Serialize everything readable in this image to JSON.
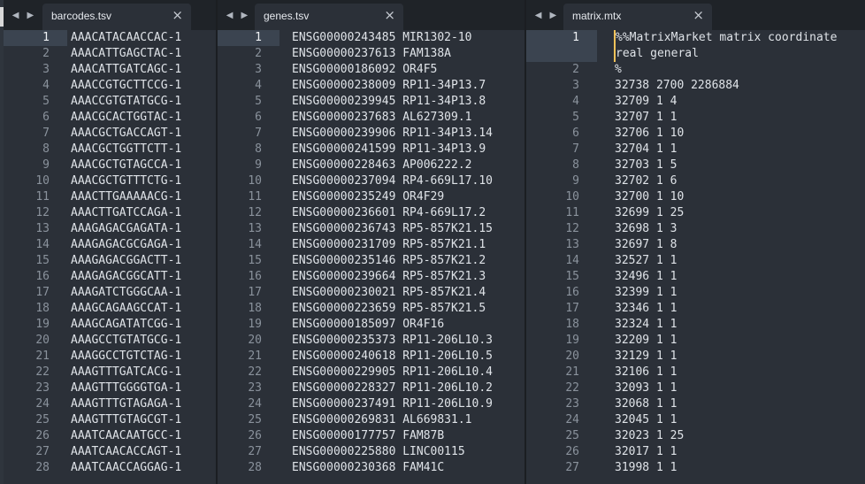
{
  "panes": [
    {
      "tab": "barcodes.tsv",
      "lines": [
        {
          "n": "1",
          "t": "AAACATACAACCAC-1"
        },
        {
          "n": "2",
          "t": "AAACATTGAGCTAC-1"
        },
        {
          "n": "3",
          "t": "AAACATTGATCAGC-1"
        },
        {
          "n": "4",
          "t": "AAACCGTGCTTCCG-1"
        },
        {
          "n": "5",
          "t": "AAACCGTGTATGCG-1"
        },
        {
          "n": "6",
          "t": "AAACGCACTGGTAC-1"
        },
        {
          "n": "7",
          "t": "AAACGCTGACCAGT-1"
        },
        {
          "n": "8",
          "t": "AAACGCTGGTTCTT-1"
        },
        {
          "n": "9",
          "t": "AAACGCTGTAGCCA-1"
        },
        {
          "n": "10",
          "t": "AAACGCTGTTTCTG-1"
        },
        {
          "n": "11",
          "t": "AAACTTGAAAAACG-1"
        },
        {
          "n": "12",
          "t": "AAACTTGATCCAGA-1"
        },
        {
          "n": "13",
          "t": "AAAGAGACGAGATA-1"
        },
        {
          "n": "14",
          "t": "AAAGAGACGCGAGA-1"
        },
        {
          "n": "15",
          "t": "AAAGAGACGGACTT-1"
        },
        {
          "n": "16",
          "t": "AAAGAGACGGCATT-1"
        },
        {
          "n": "17",
          "t": "AAAGATCTGGGCAA-1"
        },
        {
          "n": "18",
          "t": "AAAGCAGAAGCCAT-1"
        },
        {
          "n": "19",
          "t": "AAAGCAGATATCGG-1"
        },
        {
          "n": "20",
          "t": "AAAGCCTGTATGCG-1"
        },
        {
          "n": "21",
          "t": "AAAGGCCTGTCTAG-1"
        },
        {
          "n": "22",
          "t": "AAAGTTTGATCACG-1"
        },
        {
          "n": "23",
          "t": "AAAGTTTGGGGTGA-1"
        },
        {
          "n": "24",
          "t": "AAAGTTTGTAGAGA-1"
        },
        {
          "n": "25",
          "t": "AAAGTTTGTAGCGT-1"
        },
        {
          "n": "26",
          "t": "AAATCAACAATGCC-1"
        },
        {
          "n": "27",
          "t": "AAATCAACACCAGT-1"
        },
        {
          "n": "28",
          "t": "AAATCAACCAGGAG-1"
        }
      ]
    },
    {
      "tab": "genes.tsv",
      "lines": [
        {
          "n": "1",
          "t": "ENSG00000243485 MIR1302-10"
        },
        {
          "n": "2",
          "t": "ENSG00000237613 FAM138A"
        },
        {
          "n": "3",
          "t": "ENSG00000186092 OR4F5"
        },
        {
          "n": "4",
          "t": "ENSG00000238009 RP11-34P13.7"
        },
        {
          "n": "5",
          "t": "ENSG00000239945 RP11-34P13.8"
        },
        {
          "n": "6",
          "t": "ENSG00000237683 AL627309.1"
        },
        {
          "n": "7",
          "t": "ENSG00000239906 RP11-34P13.14"
        },
        {
          "n": "8",
          "t": "ENSG00000241599 RP11-34P13.9"
        },
        {
          "n": "9",
          "t": "ENSG00000228463 AP006222.2"
        },
        {
          "n": "10",
          "t": "ENSG00000237094 RP4-669L17.10"
        },
        {
          "n": "11",
          "t": "ENSG00000235249 OR4F29"
        },
        {
          "n": "12",
          "t": "ENSG00000236601 RP4-669L17.2"
        },
        {
          "n": "13",
          "t": "ENSG00000236743 RP5-857K21.15"
        },
        {
          "n": "14",
          "t": "ENSG00000231709 RP5-857K21.1"
        },
        {
          "n": "15",
          "t": "ENSG00000235146 RP5-857K21.2"
        },
        {
          "n": "16",
          "t": "ENSG00000239664 RP5-857K21.3"
        },
        {
          "n": "17",
          "t": "ENSG00000230021 RP5-857K21.4"
        },
        {
          "n": "18",
          "t": "ENSG00000223659 RP5-857K21.5"
        },
        {
          "n": "19",
          "t": "ENSG00000185097 OR4F16"
        },
        {
          "n": "20",
          "t": "ENSG00000235373 RP11-206L10.3"
        },
        {
          "n": "21",
          "t": "ENSG00000240618 RP11-206L10.5"
        },
        {
          "n": "22",
          "t": "ENSG00000229905 RP11-206L10.4"
        },
        {
          "n": "23",
          "t": "ENSG00000228327 RP11-206L10.2"
        },
        {
          "n": "24",
          "t": "ENSG00000237491 RP11-206L10.9"
        },
        {
          "n": "25",
          "t": "ENSG00000269831 AL669831.1"
        },
        {
          "n": "26",
          "t": "ENSG00000177757 FAM87B"
        },
        {
          "n": "27",
          "t": "ENSG00000225880 LINC00115"
        },
        {
          "n": "28",
          "t": "ENSG00000230368 FAM41C"
        }
      ]
    },
    {
      "tab": "matrix.mtx",
      "lines": [
        {
          "n": "1",
          "t": "%%MatrixMarket matrix coordinate real general",
          "multi": true
        },
        {
          "n": "2",
          "t": "%"
        },
        {
          "n": "3",
          "t": "32738 2700 2286884"
        },
        {
          "n": "4",
          "t": "32709 1 4"
        },
        {
          "n": "5",
          "t": "32707 1 1"
        },
        {
          "n": "6",
          "t": "32706 1 10"
        },
        {
          "n": "7",
          "t": "32704 1 1"
        },
        {
          "n": "8",
          "t": "32703 1 5"
        },
        {
          "n": "9",
          "t": "32702 1 6"
        },
        {
          "n": "10",
          "t": "32700 1 10"
        },
        {
          "n": "11",
          "t": "32699 1 25"
        },
        {
          "n": "12",
          "t": "32698 1 3"
        },
        {
          "n": "13",
          "t": "32697 1 8"
        },
        {
          "n": "14",
          "t": "32527 1 1"
        },
        {
          "n": "15",
          "t": "32496 1 1"
        },
        {
          "n": "16",
          "t": "32399 1 1"
        },
        {
          "n": "17",
          "t": "32346 1 1"
        },
        {
          "n": "18",
          "t": "32324 1 1"
        },
        {
          "n": "19",
          "t": "32209 1 1"
        },
        {
          "n": "20",
          "t": "32129 1 1"
        },
        {
          "n": "21",
          "t": "32106 1 1"
        },
        {
          "n": "22",
          "t": "32093 1 1"
        },
        {
          "n": "23",
          "t": "32068 1 1"
        },
        {
          "n": "24",
          "t": "32045 1 1"
        },
        {
          "n": "25",
          "t": "32023 1 25"
        },
        {
          "n": "26",
          "t": "32017 1 1"
        },
        {
          "n": "27",
          "t": "31998 1 1"
        }
      ]
    }
  ],
  "icons": {
    "back": "◀",
    "forward": "▶",
    "close": "×"
  },
  "colors": {
    "editor_bg": "#2b3038",
    "tabbar_bg": "#1f2328",
    "text": "#dfe3e8",
    "gutter_text": "#8a929c",
    "current_line": "#3b4450",
    "caret": "#f3c25a"
  }
}
